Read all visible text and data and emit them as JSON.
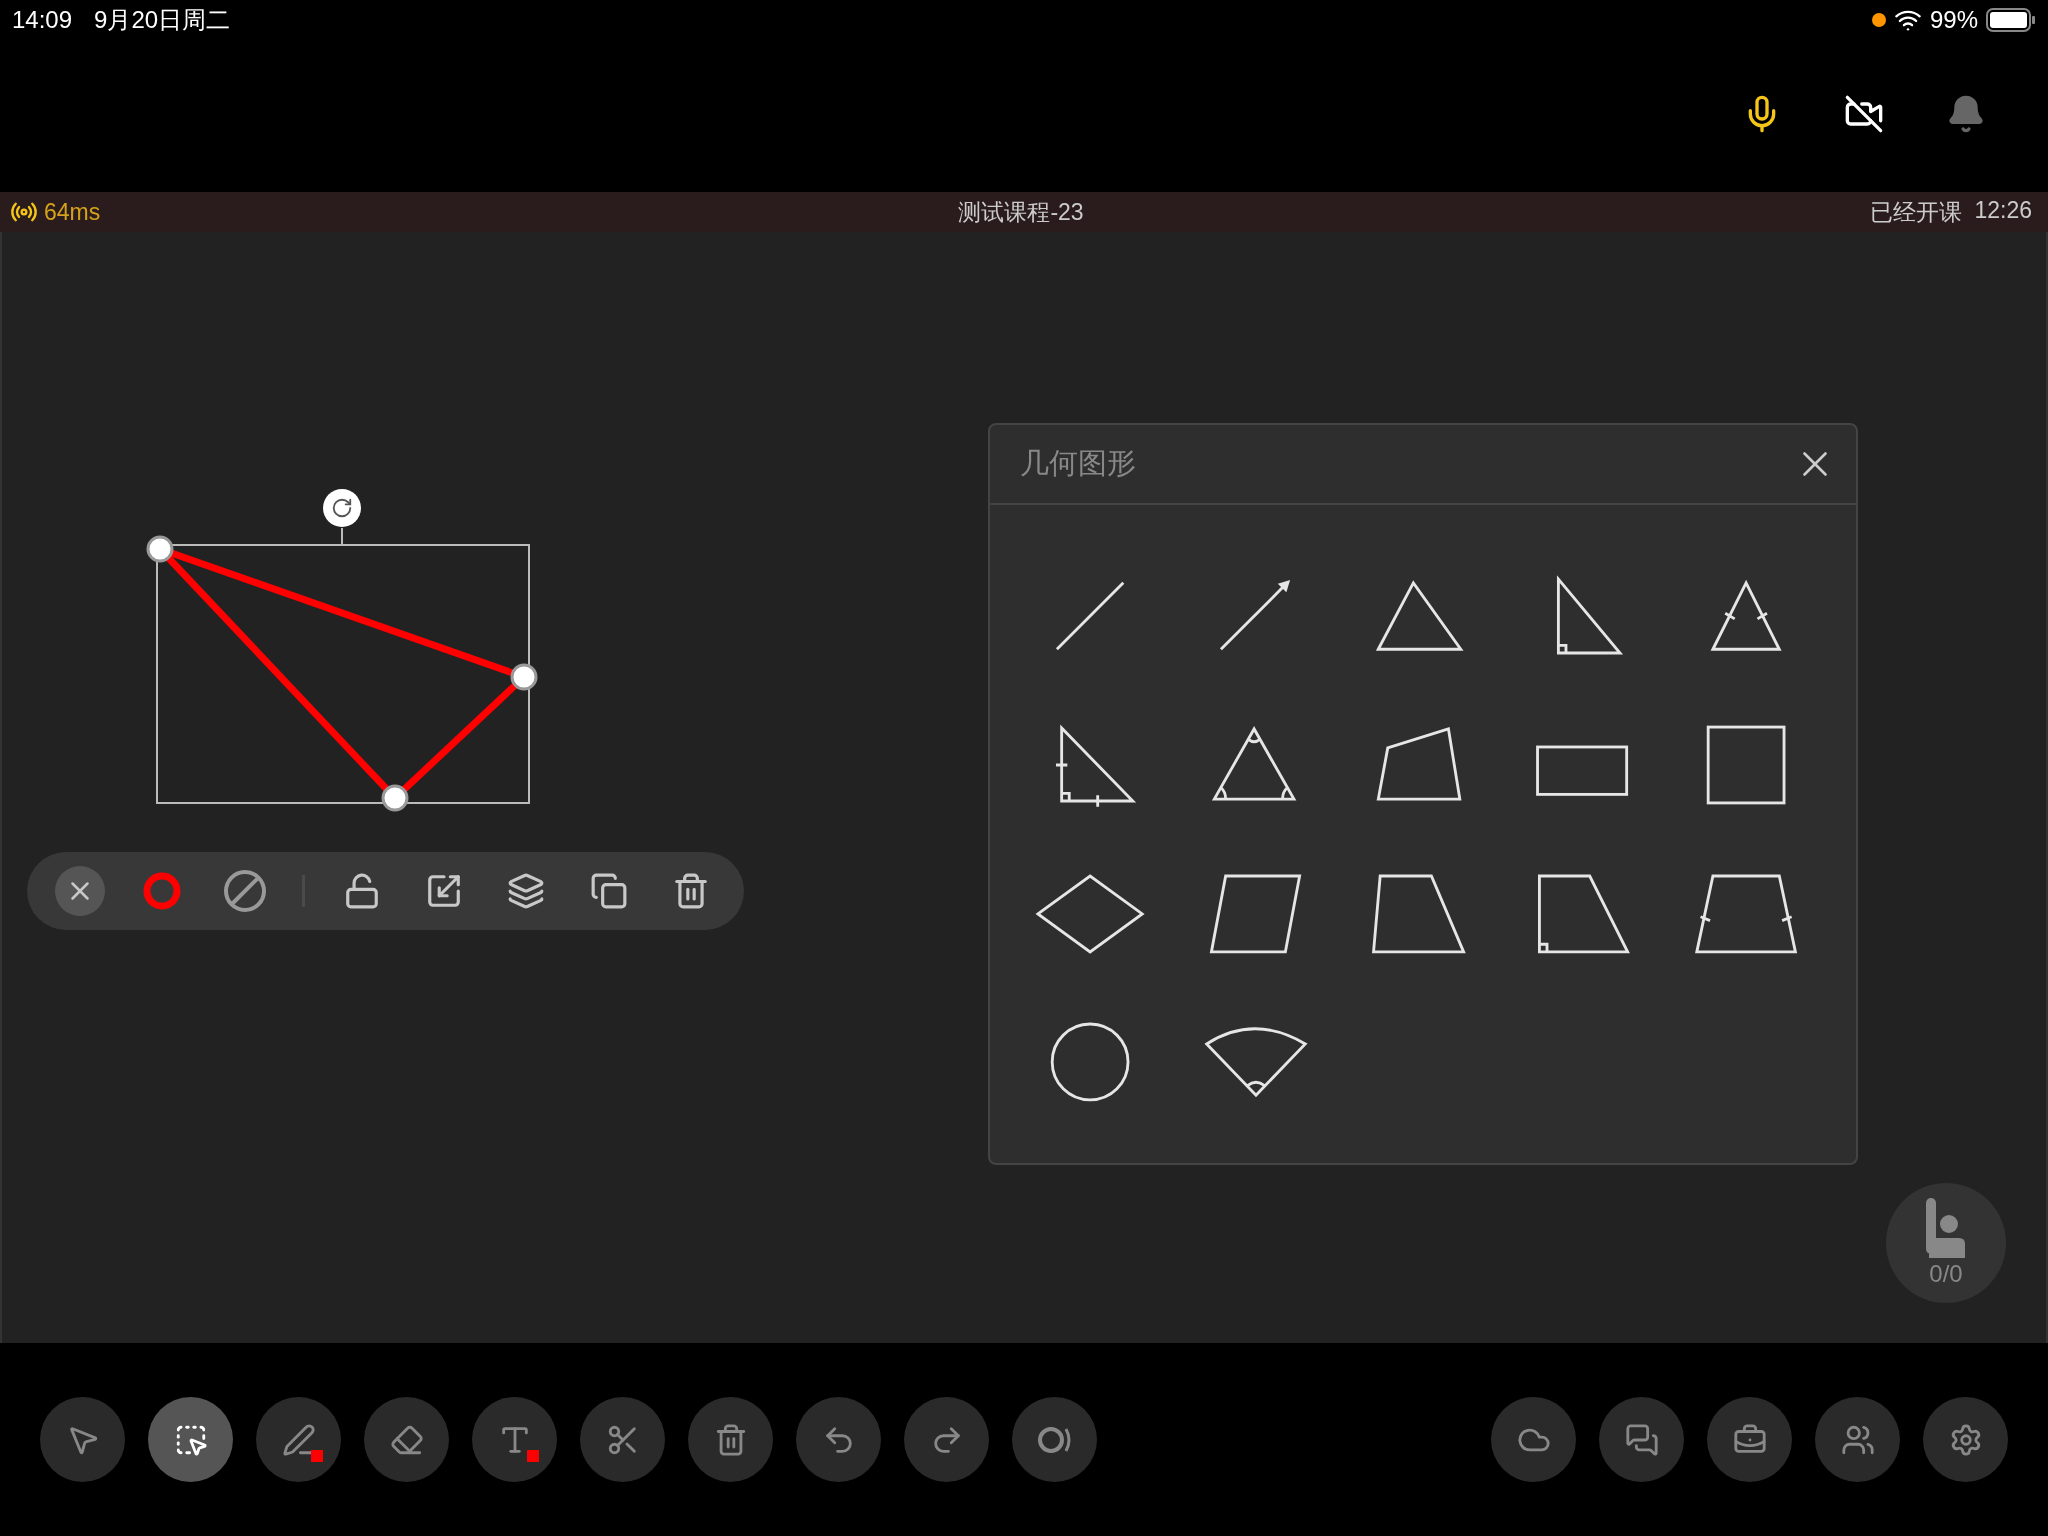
{
  "status_bar": {
    "time": "14:09",
    "date": "9月20日周二",
    "battery": "99%"
  },
  "header": {
    "controls": [
      {
        "kind": "microphone",
        "on": true
      },
      {
        "kind": "camera",
        "on": false
      },
      {
        "kind": "notifications"
      }
    ]
  },
  "class_bar": {
    "latency": "64ms",
    "title": "测试课程-23",
    "status": "已经开课",
    "elapsed": "12:26"
  },
  "canvas": {
    "shape": {
      "kind": "triangle",
      "color": "#ff0000",
      "selected": true
    }
  },
  "object_toolbar": [
    {
      "kind": "close"
    },
    {
      "kind": "stroke",
      "color": "#ff0000"
    },
    {
      "kind": "fill-none"
    },
    {
      "kind": "divider"
    },
    {
      "kind": "unlock"
    },
    {
      "kind": "resize"
    },
    {
      "kind": "layers"
    },
    {
      "kind": "copy"
    },
    {
      "kind": "delete"
    }
  ],
  "shape_panel": {
    "title": "几何图形",
    "shapes": [
      {
        "kind": "line"
      },
      {
        "kind": "arrow"
      },
      {
        "kind": "triangle"
      },
      {
        "kind": "right-triangle"
      },
      {
        "kind": "isosceles-triangle"
      },
      {
        "kind": "right-isosceles-triangle"
      },
      {
        "kind": "equilateral-triangle"
      },
      {
        "kind": "quadrilateral"
      },
      {
        "kind": "rectangle"
      },
      {
        "kind": "square"
      },
      {
        "kind": "rhombus"
      },
      {
        "kind": "parallelogram"
      },
      {
        "kind": "trapezoid"
      },
      {
        "kind": "right-trapezoid"
      },
      {
        "kind": "isosceles-trapezoid"
      },
      {
        "kind": "circle"
      },
      {
        "kind": "sector"
      }
    ]
  },
  "hand_raise": {
    "count": "0/0"
  },
  "tools": [
    {
      "kind": "pointer",
      "selected": false
    },
    {
      "kind": "select",
      "selected": true
    },
    {
      "kind": "pen",
      "selected": false,
      "color": "#ff0000"
    },
    {
      "kind": "eraser",
      "selected": false
    },
    {
      "kind": "text",
      "selected": false,
      "color": "#ff0000"
    },
    {
      "kind": "cut",
      "selected": false
    },
    {
      "kind": "clear",
      "selected": false
    },
    {
      "kind": "undo",
      "selected": false
    },
    {
      "kind": "redo",
      "selected": false
    },
    {
      "kind": "laser",
      "selected": false
    }
  ],
  "side_tools": [
    {
      "kind": "cloud"
    },
    {
      "kind": "chat"
    },
    {
      "kind": "toolbox"
    },
    {
      "kind": "members"
    },
    {
      "kind": "settings"
    }
  ]
}
